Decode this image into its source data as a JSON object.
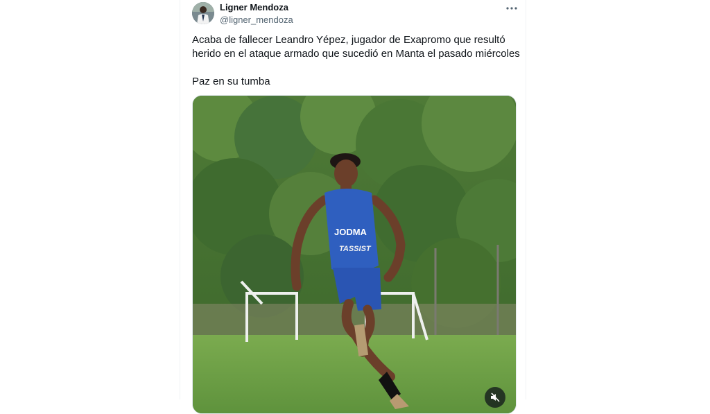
{
  "tweet": {
    "author": {
      "display_name": "Ligner Mendoza",
      "handle": "@ligner_mendoza",
      "avatar_icon": "user-avatar"
    },
    "more_icon": "more-horizontal-icon",
    "text_lines": [
      "Acaba de fallecer Leandro Yépez, jugador de Exapromo que resultó",
      "herido en el ataque armado que sucedió en Manta el pasado miércoles"
    ],
    "text_last": "Paz en su tumba",
    "media": {
      "type": "video",
      "jersey_text_1": "JODMA",
      "jersey_text_2": "TASSIST",
      "mute_icon": "volume-muted-icon"
    }
  }
}
